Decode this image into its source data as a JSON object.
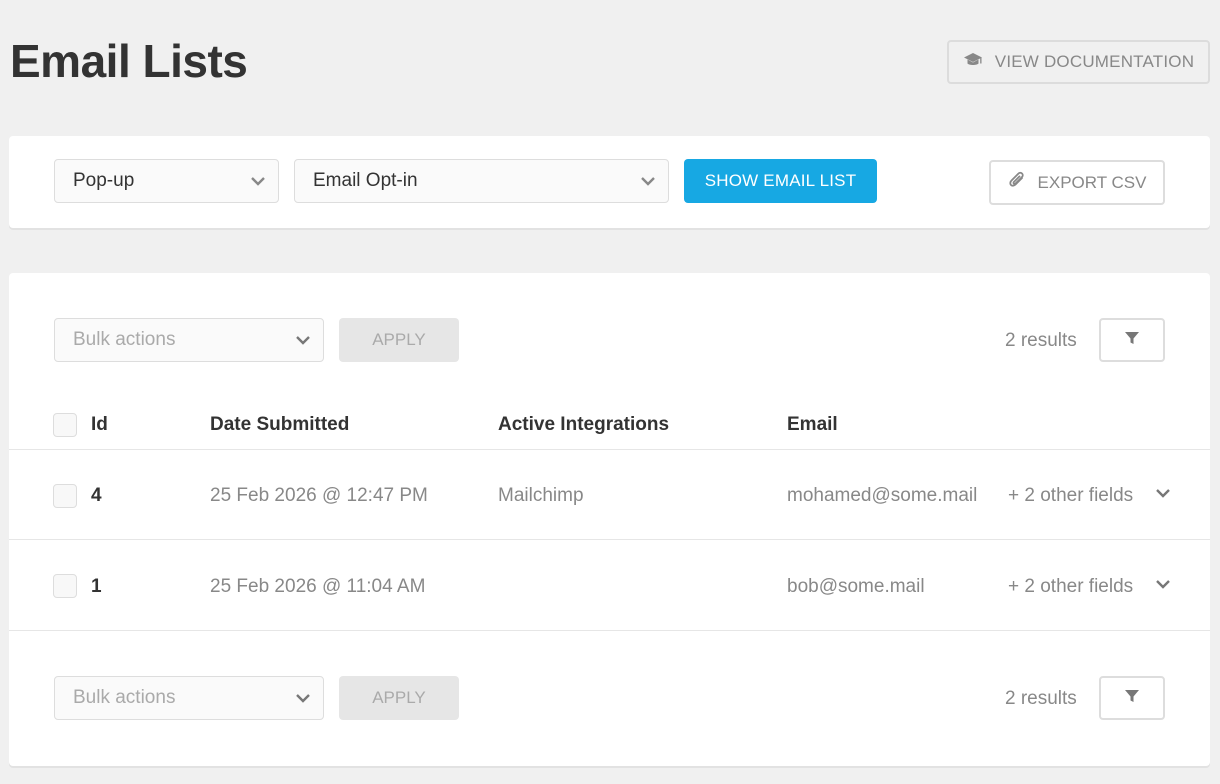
{
  "header": {
    "title": "Email Lists",
    "doc_button_label": "VIEW DOCUMENTATION"
  },
  "filters": {
    "module_type": "Pop-up",
    "module_name": "Email Opt-in",
    "show_button_label": "SHOW EMAIL LIST",
    "export_button_label": "EXPORT CSV"
  },
  "toolbar_top": {
    "bulk_placeholder": "Bulk actions",
    "apply_label": "APPLY",
    "results_text": "2 results"
  },
  "table": {
    "columns": [
      "Id",
      "Date Submitted",
      "Active Integrations",
      "Email"
    ],
    "rows": [
      {
        "id": "4",
        "date": "25 Feb 2026 @ 12:47 PM",
        "integrations": "Mailchimp",
        "email": "mohamed@some.mail",
        "more": "+ 2 other fields"
      },
      {
        "id": "1",
        "date": "25 Feb 2026 @ 11:04 AM",
        "integrations": "",
        "email": "bob@some.mail",
        "more": "+ 2 other fields"
      }
    ]
  },
  "toolbar_bottom": {
    "bulk_placeholder": "Bulk actions",
    "apply_label": "APPLY",
    "results_text": "2 results"
  },
  "colors": {
    "accent": "#17a8e3",
    "background": "#f0f0f0"
  },
  "icons": [
    "graduation-cap-icon",
    "paperclip-icon",
    "chevron-down-icon",
    "filter-icon"
  ]
}
